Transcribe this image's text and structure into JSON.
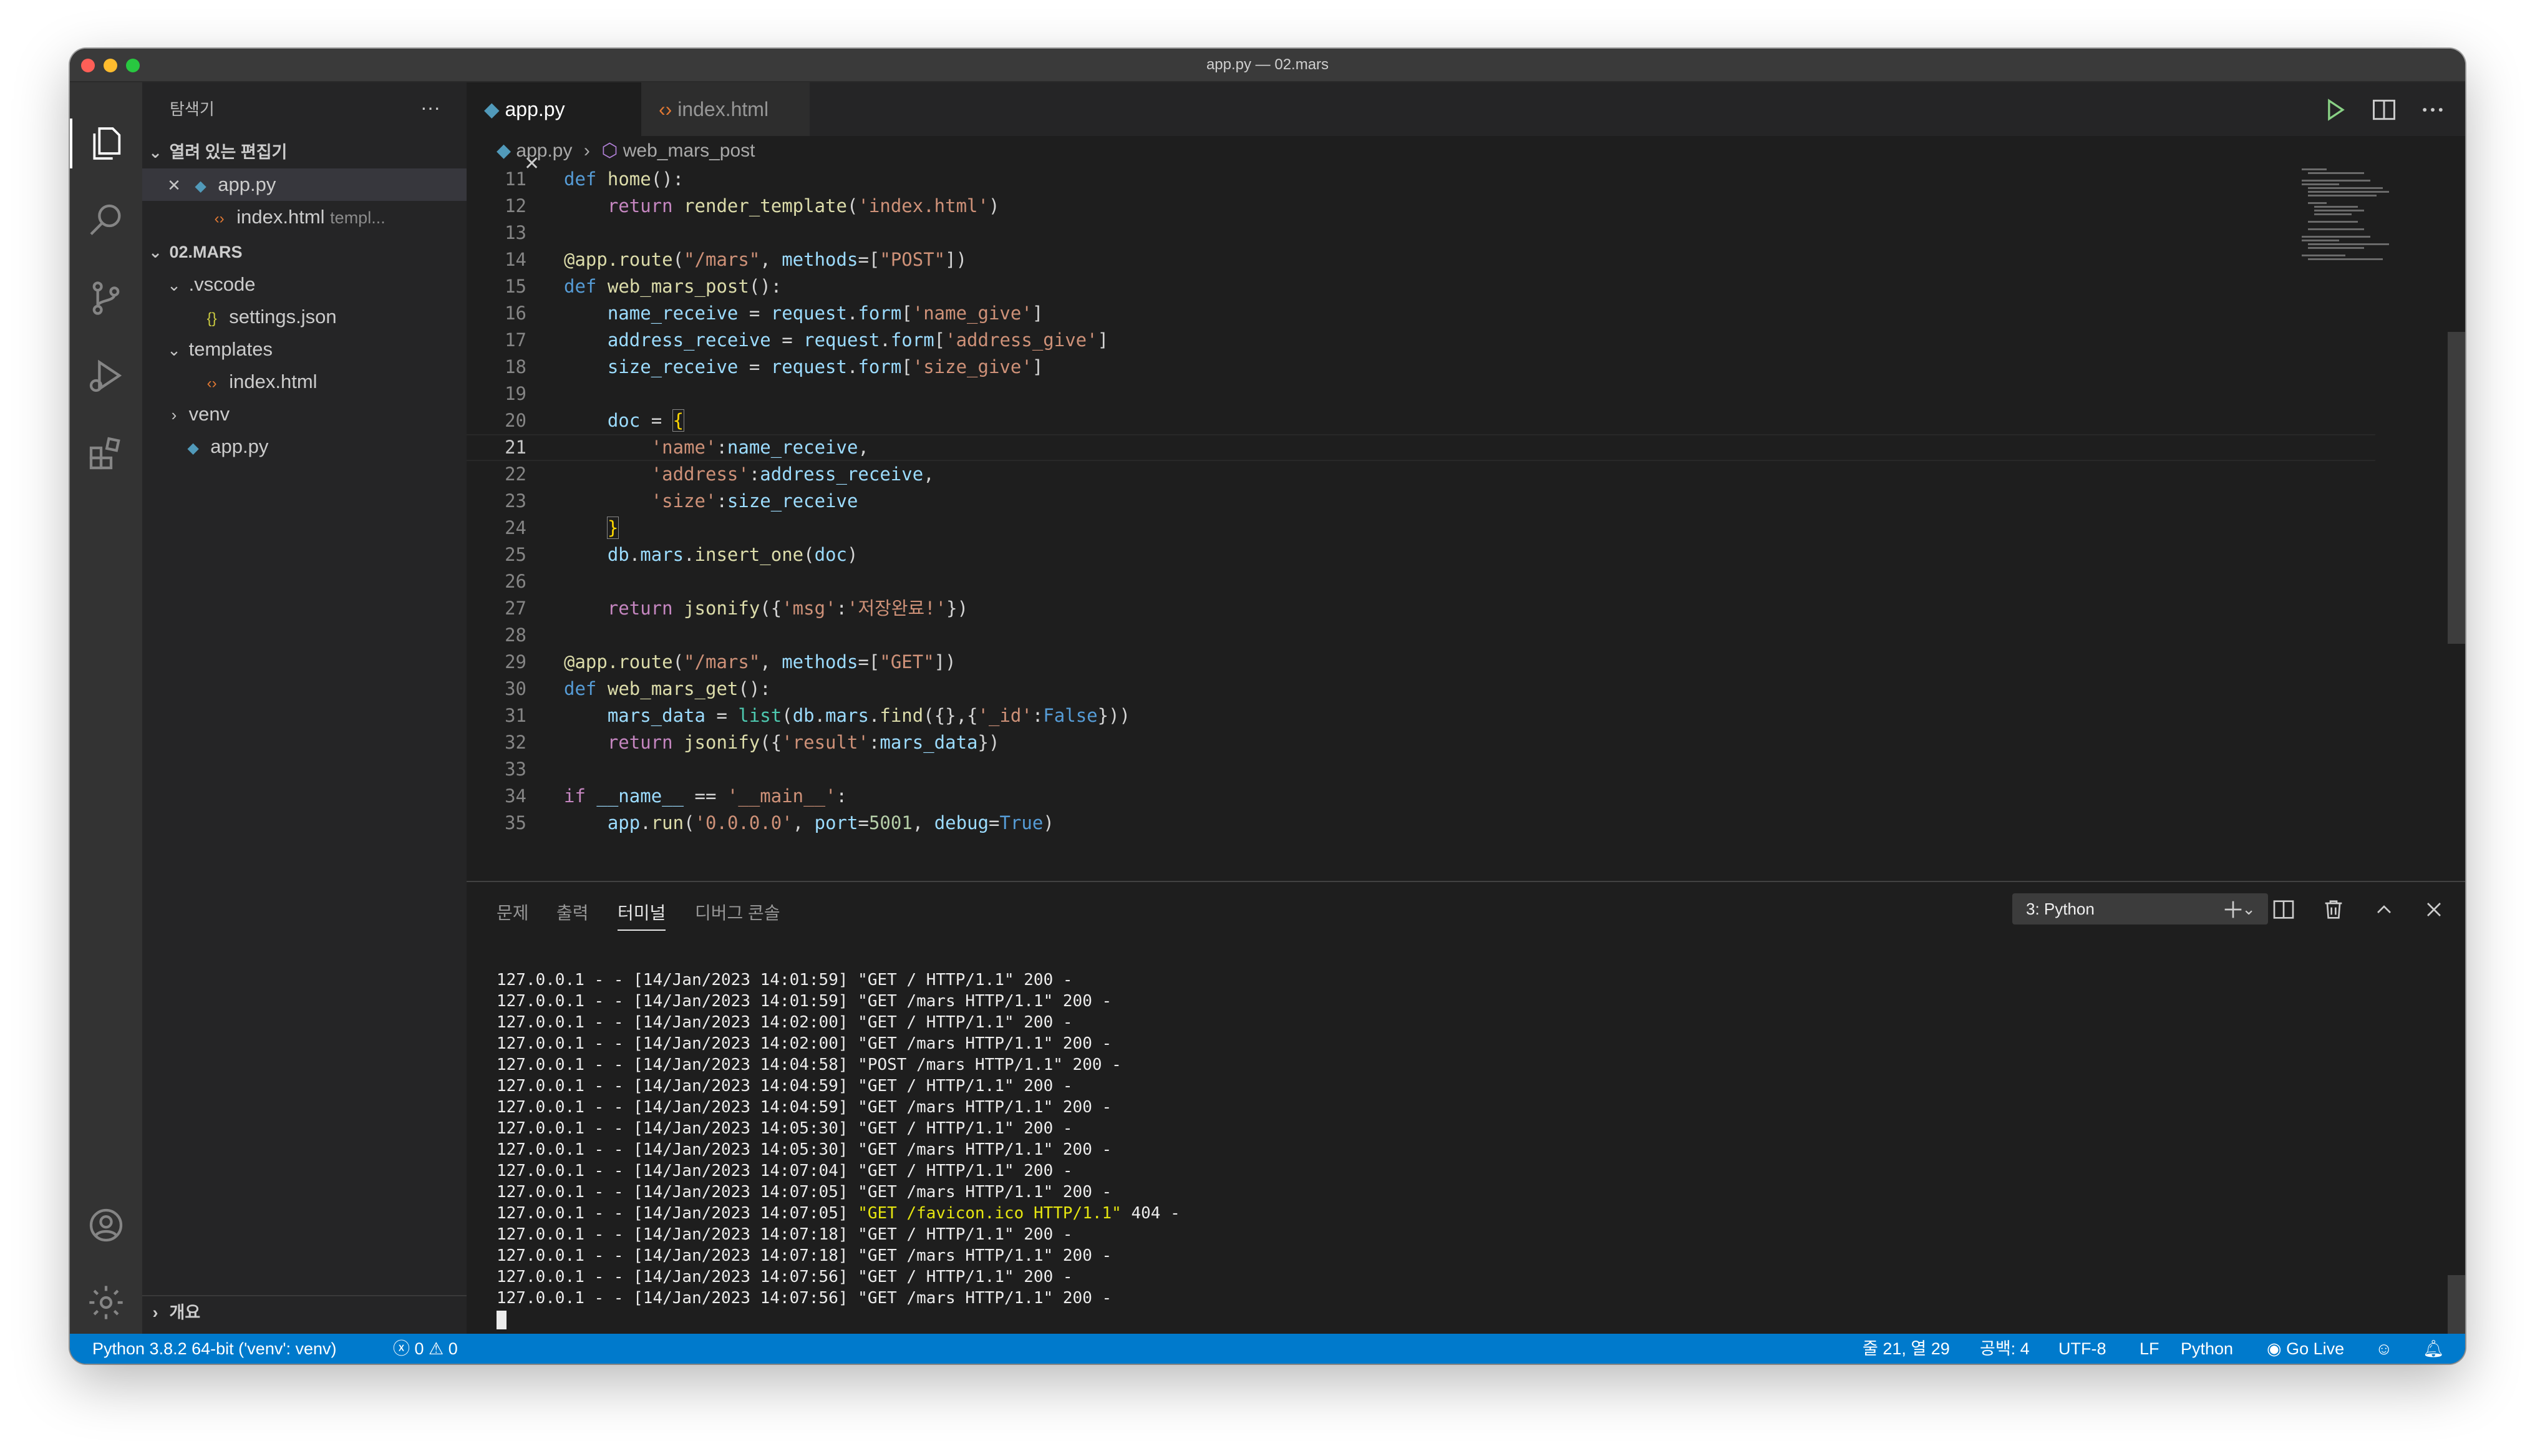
{
  "window": {
    "title": "app.py — 02.mars"
  },
  "explorer": {
    "title": "탐색기",
    "more": "···",
    "open_editors_label": "열려 있는 편집기",
    "open_editors": [
      {
        "name": "app.py",
        "detail": ""
      },
      {
        "name": "index.html",
        "detail": "templ..."
      }
    ],
    "folder_label": "02.MARS",
    "tree": [
      {
        "name": ".vscode"
      },
      {
        "name": "settings.json"
      },
      {
        "name": "templates"
      },
      {
        "name": "index.html"
      },
      {
        "name": "venv"
      },
      {
        "name": "app.py"
      }
    ],
    "outline_label": "개요"
  },
  "tabs": [
    {
      "label": "app.py",
      "close": "✕"
    },
    {
      "label": "index.html"
    }
  ],
  "breadcrumb": {
    "file": "app.py",
    "symbol": "web_mars_post"
  },
  "editor": {
    "current_line": 21,
    "lines": [
      {
        "n": "11"
      },
      {
        "n": "12"
      },
      {
        "n": "13"
      },
      {
        "n": "14"
      },
      {
        "n": "15"
      },
      {
        "n": "16"
      },
      {
        "n": "17"
      },
      {
        "n": "18"
      },
      {
        "n": "19"
      },
      {
        "n": "20"
      },
      {
        "n": "21"
      },
      {
        "n": "22"
      },
      {
        "n": "23"
      },
      {
        "n": "24"
      },
      {
        "n": "25"
      },
      {
        "n": "26"
      },
      {
        "n": "27"
      },
      {
        "n": "28"
      },
      {
        "n": "29"
      },
      {
        "n": "30"
      },
      {
        "n": "31"
      },
      {
        "n": "32"
      },
      {
        "n": "33"
      },
      {
        "n": "34"
      },
      {
        "n": "35"
      }
    ],
    "code": {
      "l11": [
        "def",
        " ",
        "home",
        "():"
      ],
      "l12": [
        "    ",
        "return",
        " ",
        "render_template",
        "(",
        "'index.html'",
        ")"
      ],
      "l14": [
        "@app.route",
        "(",
        "\"/mars\"",
        ", ",
        "methods",
        "=[",
        "\"POST\"",
        "])"
      ],
      "l15": [
        "def",
        " ",
        "web_mars_post",
        "():"
      ],
      "l16": [
        "    ",
        "name_receive",
        " = ",
        "request",
        ".",
        "form",
        "[",
        "'name_give'",
        "]"
      ],
      "l17": [
        "    ",
        "address_receive",
        " = ",
        "request",
        ".",
        "form",
        "[",
        "'address_give'",
        "]"
      ],
      "l18": [
        "    ",
        "size_receive",
        " = ",
        "request",
        ".",
        "form",
        "[",
        "'size_give'",
        "]"
      ],
      "l20": [
        "    ",
        "doc",
        " = ",
        "{"
      ],
      "l21": [
        "        ",
        "'name'",
        ":",
        "name_receive",
        ","
      ],
      "l22": [
        "        ",
        "'address'",
        ":",
        "address_receive",
        ","
      ],
      "l23": [
        "        ",
        "'size'",
        ":",
        "size_receive"
      ],
      "l24": [
        "    ",
        "}"
      ],
      "l25": [
        "    ",
        "db",
        ".",
        "mars",
        ".",
        "insert_one",
        "(",
        "doc",
        ")"
      ],
      "l27": [
        "    ",
        "return",
        " ",
        "jsonify",
        "({",
        "'msg'",
        ":",
        "'저장완료!'",
        "})"
      ],
      "l29": [
        "@app.route",
        "(",
        "\"/mars\"",
        ", ",
        "methods",
        "=[",
        "\"GET\"",
        "])"
      ],
      "l30": [
        "def",
        " ",
        "web_mars_get",
        "():"
      ],
      "l31": [
        "    ",
        "mars_data",
        " = ",
        "list",
        "(",
        "db",
        ".",
        "mars",
        ".",
        "find",
        "({},{",
        "'_id'",
        ":",
        "False",
        "}))"
      ],
      "l32": [
        "    ",
        "return",
        " ",
        "jsonify",
        "({",
        "'result'",
        ":",
        "mars_data",
        "})"
      ],
      "l34": [
        "if",
        " ",
        "__name__",
        " == ",
        "'__main__'",
        ":"
      ],
      "l35": [
        "    ",
        "app",
        ".",
        "run",
        "(",
        "'0.0.0.0'",
        ", ",
        "port",
        "=",
        "5001",
        ", ",
        "debug",
        "=",
        "True",
        ")"
      ]
    }
  },
  "panel": {
    "tabs": [
      "문제",
      "출력",
      "터미널",
      "디버그 콘솔"
    ],
    "active_tab": "터미널",
    "terminal_select": "3: Python",
    "terminal_lines": [
      {
        "pre": "127.0.0.1 - - [14/Jan/2023 14:01:59] \"GET / HTTP/1.1\" 200 -",
        "hl": "",
        "post": ""
      },
      {
        "pre": "127.0.0.1 - - [14/Jan/2023 14:01:59] \"GET /mars HTTP/1.1\" 200 -",
        "hl": "",
        "post": ""
      },
      {
        "pre": "127.0.0.1 - - [14/Jan/2023 14:02:00] \"GET / HTTP/1.1\" 200 -",
        "hl": "",
        "post": ""
      },
      {
        "pre": "127.0.0.1 - - [14/Jan/2023 14:02:00] \"GET /mars HTTP/1.1\" 200 -",
        "hl": "",
        "post": ""
      },
      {
        "pre": "127.0.0.1 - - [14/Jan/2023 14:04:58] \"POST /mars HTTP/1.1\" 200 -",
        "hl": "",
        "post": ""
      },
      {
        "pre": "127.0.0.1 - - [14/Jan/2023 14:04:59] \"GET / HTTP/1.1\" 200 -",
        "hl": "",
        "post": ""
      },
      {
        "pre": "127.0.0.1 - - [14/Jan/2023 14:04:59] \"GET /mars HTTP/1.1\" 200 -",
        "hl": "",
        "post": ""
      },
      {
        "pre": "127.0.0.1 - - [14/Jan/2023 14:05:30] \"GET / HTTP/1.1\" 200 -",
        "hl": "",
        "post": ""
      },
      {
        "pre": "127.0.0.1 - - [14/Jan/2023 14:05:30] \"GET /mars HTTP/1.1\" 200 -",
        "hl": "",
        "post": ""
      },
      {
        "pre": "127.0.0.1 - - [14/Jan/2023 14:07:04] \"GET / HTTP/1.1\" 200 -",
        "hl": "",
        "post": ""
      },
      {
        "pre": "127.0.0.1 - - [14/Jan/2023 14:07:05] \"GET /mars HTTP/1.1\" 200 -",
        "hl": "",
        "post": ""
      },
      {
        "pre": "127.0.0.1 - - [14/Jan/2023 14:07:05] ",
        "hl": "\"GET /favicon.ico HTTP/1.1\"",
        "post": " 404 -"
      },
      {
        "pre": "127.0.0.1 - - [14/Jan/2023 14:07:18] \"GET / HTTP/1.1\" 200 -",
        "hl": "",
        "post": ""
      },
      {
        "pre": "127.0.0.1 - - [14/Jan/2023 14:07:18] \"GET /mars HTTP/1.1\" 200 -",
        "hl": "",
        "post": ""
      },
      {
        "pre": "127.0.0.1 - - [14/Jan/2023 14:07:56] \"GET / HTTP/1.1\" 200 -",
        "hl": "",
        "post": ""
      },
      {
        "pre": "127.0.0.1 - - [14/Jan/2023 14:07:56] \"GET /mars HTTP/1.1\" 200 -",
        "hl": "",
        "post": ""
      }
    ]
  },
  "status": {
    "interpreter": "Python 3.8.2 64-bit ('venv': venv)",
    "errors": "0",
    "warnings": "0",
    "position": "줄 21, 열 29",
    "spaces": "공백: 4",
    "encoding": "UTF-8",
    "eol": "LF",
    "language": "Python",
    "golive": "Go Live"
  },
  "colors": {
    "statusbar": "#007acc",
    "editor_bg": "#1e1e1e",
    "sidebar_bg": "#252526",
    "activitybar_bg": "#333333",
    "terminal_highlight": "#e5e510"
  },
  "icons": {
    "activity": [
      "explorer-icon",
      "search-icon",
      "source-control-icon",
      "run-debug-icon",
      "extensions-icon",
      "account-icon",
      "gear-icon"
    ],
    "editor_actions": [
      "run-icon",
      "split-editor-icon",
      "more-icon"
    ],
    "panel_actions": [
      "plus-icon",
      "split-terminal-icon",
      "trash-icon",
      "chevron-up-icon",
      "close-icon"
    ]
  }
}
